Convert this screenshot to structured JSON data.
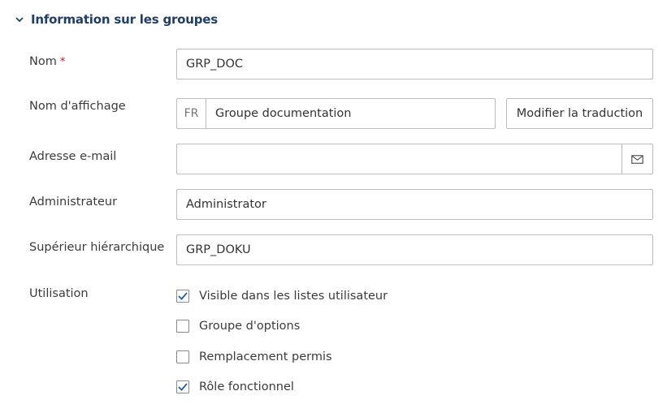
{
  "section": {
    "title": "Information sur les groupes",
    "chevron_icon": "chevron-down-icon",
    "accent_color": "#1f3f66"
  },
  "fields": {
    "name": {
      "label": "Nom",
      "required_marker": "*",
      "value": "GRP_DOC"
    },
    "display_name": {
      "label": "Nom d'affichage",
      "language": "FR",
      "value": "Groupe documentation",
      "edit_translation_label": "Modifier la traduction"
    },
    "email": {
      "label": "Adresse e-mail",
      "value": "",
      "button_icon": "mail-icon"
    },
    "administrator": {
      "label": "Administrateur",
      "value": "Administrator"
    },
    "supervisor": {
      "label": "Supérieur hiérarchique",
      "value": "GRP_DOKU"
    }
  },
  "usage": {
    "label": "Utilisation",
    "options": [
      {
        "label": "Visible dans les listes utilisateur",
        "checked": true
      },
      {
        "label": "Groupe d'options",
        "checked": false
      },
      {
        "label": "Remplacement permis",
        "checked": false
      },
      {
        "label": "Rôle fonctionnel",
        "checked": true
      }
    ],
    "check_color": "#1f5fa8"
  }
}
